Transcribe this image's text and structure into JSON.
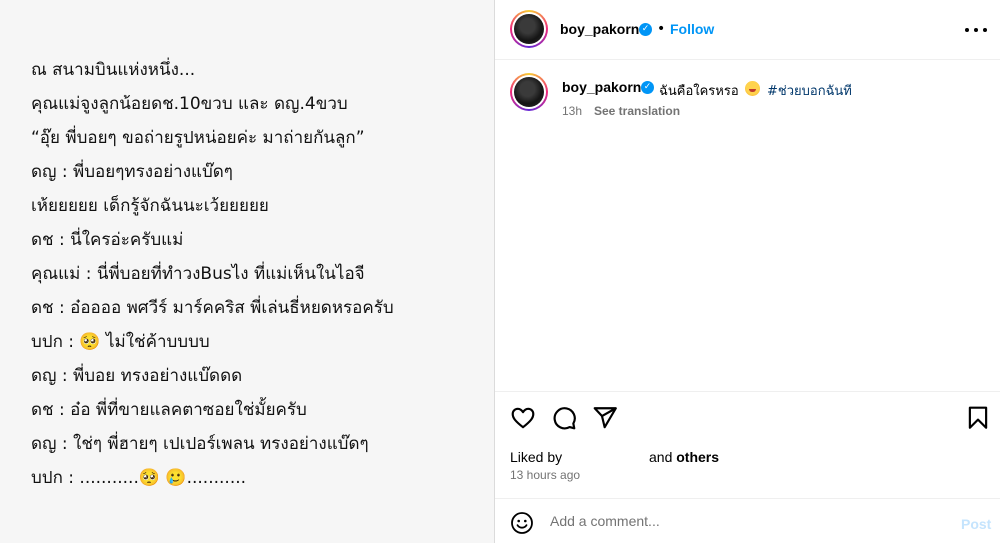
{
  "post": {
    "lines": [
      "ณ สนามบินแห่งหนึ่ง...",
      "คุณแม่จูงลูกน้อยดช.10ขวบ และ ดญ.4ขวบ",
      "“อุ๊ย พี่บอยๆ ขอถ่ายรูปหน่อยค่ะ มาถ่ายกันลูก”",
      "ดญ : พี่บอยๆทรงอย่างแบ๊ดๆ",
      "เห้ยยยยย เด็กรู้จักฉันนะเว้ยยยยย",
      "ดช : นี่ใครอ่ะครับแม่",
      "คุณแม่ : นี่พี่บอยที่ทำวงBusไง ที่แม่เห็นในไอจี",
      "ดช : อ๋ออออ พศวีร์ มาร์คคริส พี่เล่นธี่หยดหรอครับ",
      "บปก : 🥺 ไม่ใช่ค้าบบบบ",
      "ดญ : พี่บอย ทรงอย่างแบ๊ดดด",
      "ดช : อ๋อ พี่ที่ขายแลคตาซอยใช่มั้ยครับ",
      "ดญ : ใช่ๆ พี่ฮายๆ เปเปอร์เพลน ทรงอย่างแบ๊ดๆ",
      "บปก : ...........🥺 🥲..........."
    ]
  },
  "header": {
    "username": "boy_pakorn",
    "dot": "•",
    "follow_label": "Follow",
    "more_icon": "more-horizontal-icon"
  },
  "caption": {
    "username": "boy_pakorn",
    "text": "ฉันคือใครหรอ",
    "hashtag": "#ช่วยบอกฉันที",
    "time": "13h",
    "see_translation": "See translation"
  },
  "actions": {
    "like_icon": "heart-icon",
    "comment_icon": "comment-icon",
    "share_icon": "share-icon",
    "save_icon": "bookmark-icon"
  },
  "likes": {
    "liked_by_label": "Liked by",
    "and_label": "and",
    "others_label": "others",
    "time_ago": "13 hours ago"
  },
  "comment": {
    "placeholder": "Add a comment...",
    "post_label": "Post",
    "emoji_icon": "smiley-icon"
  },
  "colors": {
    "accent": "#0095f6",
    "hashtag": "#00376b",
    "muted": "#737373",
    "post_disabled": "#c5e4fd"
  }
}
